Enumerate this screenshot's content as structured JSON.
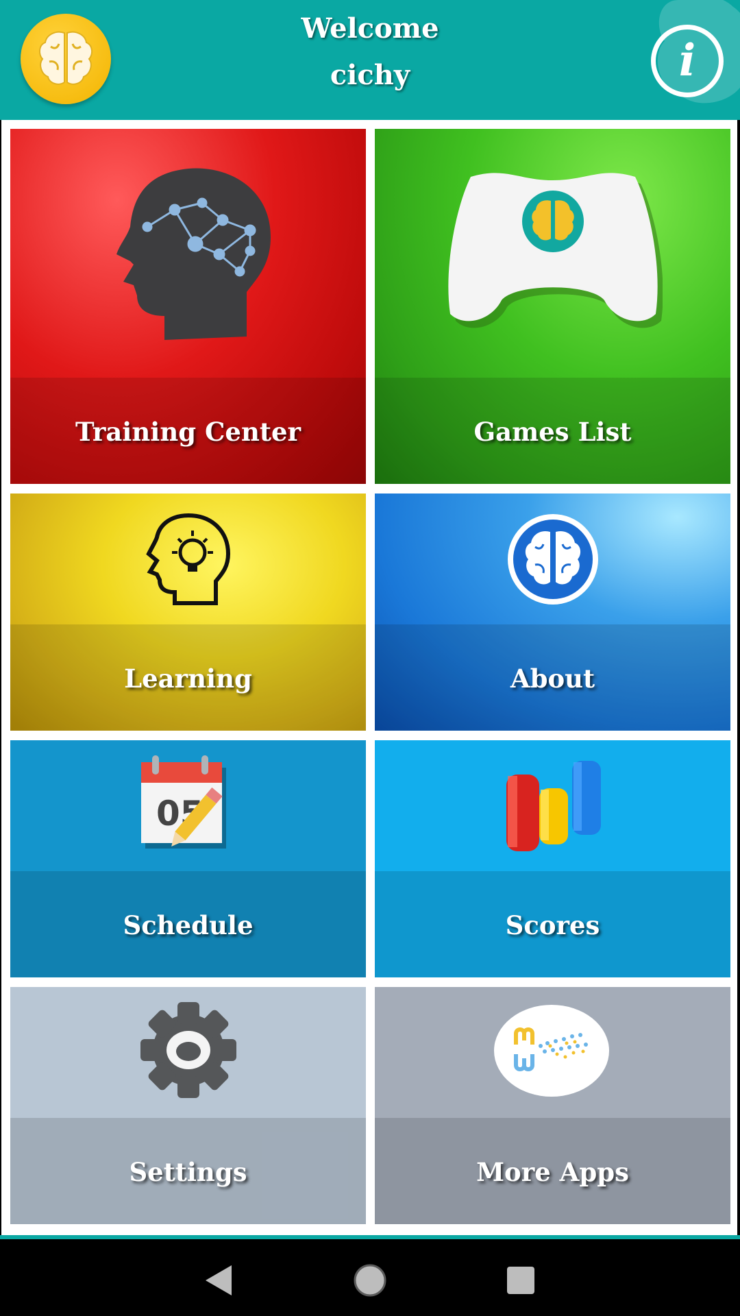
{
  "header": {
    "welcome": "Welcome",
    "username": "cichy",
    "logo_icon": "brain-icon",
    "info_icon": "info-icon",
    "info_glyph": "i"
  },
  "tiles": [
    {
      "label": "Training Center",
      "icon": "head-network-icon",
      "colors": [
        "#e02020",
        "#b30a0a"
      ]
    },
    {
      "label": "Games List",
      "icon": "gamepad-icon",
      "colors": [
        "#4fcc28",
        "#2f9a1a"
      ]
    },
    {
      "label": "Learning",
      "icon": "head-lightbulb-icon",
      "colors": [
        "#f5e030",
        "#d4aa10"
      ]
    },
    {
      "label": "About",
      "icon": "brain-circle-icon",
      "colors": [
        "#2f95e6",
        "#0c62c4"
      ]
    },
    {
      "label": "Schedule",
      "icon": "calendar-icon",
      "calendar_day": "05",
      "colors": [
        "#1495cc",
        "#0f83b6"
      ]
    },
    {
      "label": "Scores",
      "icon": "bar-chart-icon",
      "colors": [
        "#12aeed",
        "#0d98d2"
      ]
    },
    {
      "label": "Settings",
      "icon": "gear-icon",
      "colors": [
        "#b8c6d4",
        "#a0afbd"
      ]
    },
    {
      "label": "More Apps",
      "icon": "developer-logo-icon",
      "colors": [
        "#a4acb8",
        "#8c93a0"
      ]
    }
  ],
  "navbar": {
    "back_icon": "back-triangle-icon",
    "home_icon": "home-circle-icon",
    "recents_icon": "recents-square-icon"
  }
}
